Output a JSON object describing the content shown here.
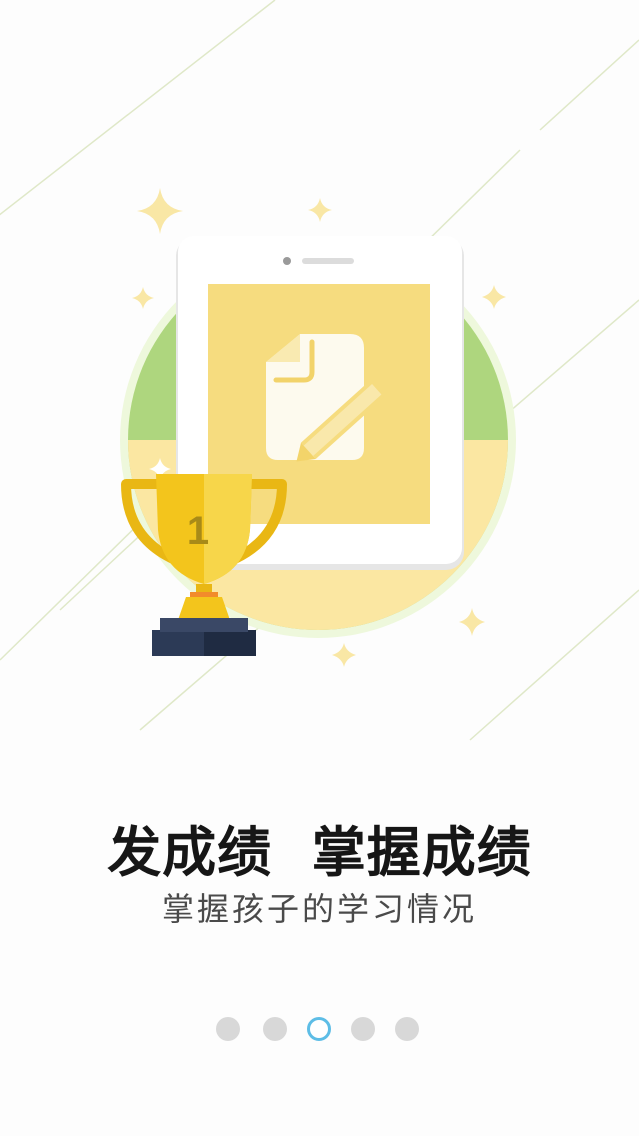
{
  "screen": "onboarding-page-3",
  "illustration": {
    "icons": [
      "tablet-icon",
      "document-edit-icon",
      "trophy-icon",
      "sparkle-icon"
    ],
    "trophy_rank": "1",
    "colors": {
      "circle_green": "#aed67e",
      "circle_yellow": "#fbe7a2",
      "screen_yellow": "#f6dc7f",
      "trophy_gold": "#f3c51c",
      "trophy_base": "#2c3a56",
      "sparkle": "#f9e7a5"
    }
  },
  "headline": "发成绩  掌握成绩",
  "subtitle": "掌握孩子的学习情况",
  "pagination": {
    "count": 5,
    "active_index": 2,
    "active_color": "#5dbde6",
    "inactive_color": "#d8d8d8"
  }
}
